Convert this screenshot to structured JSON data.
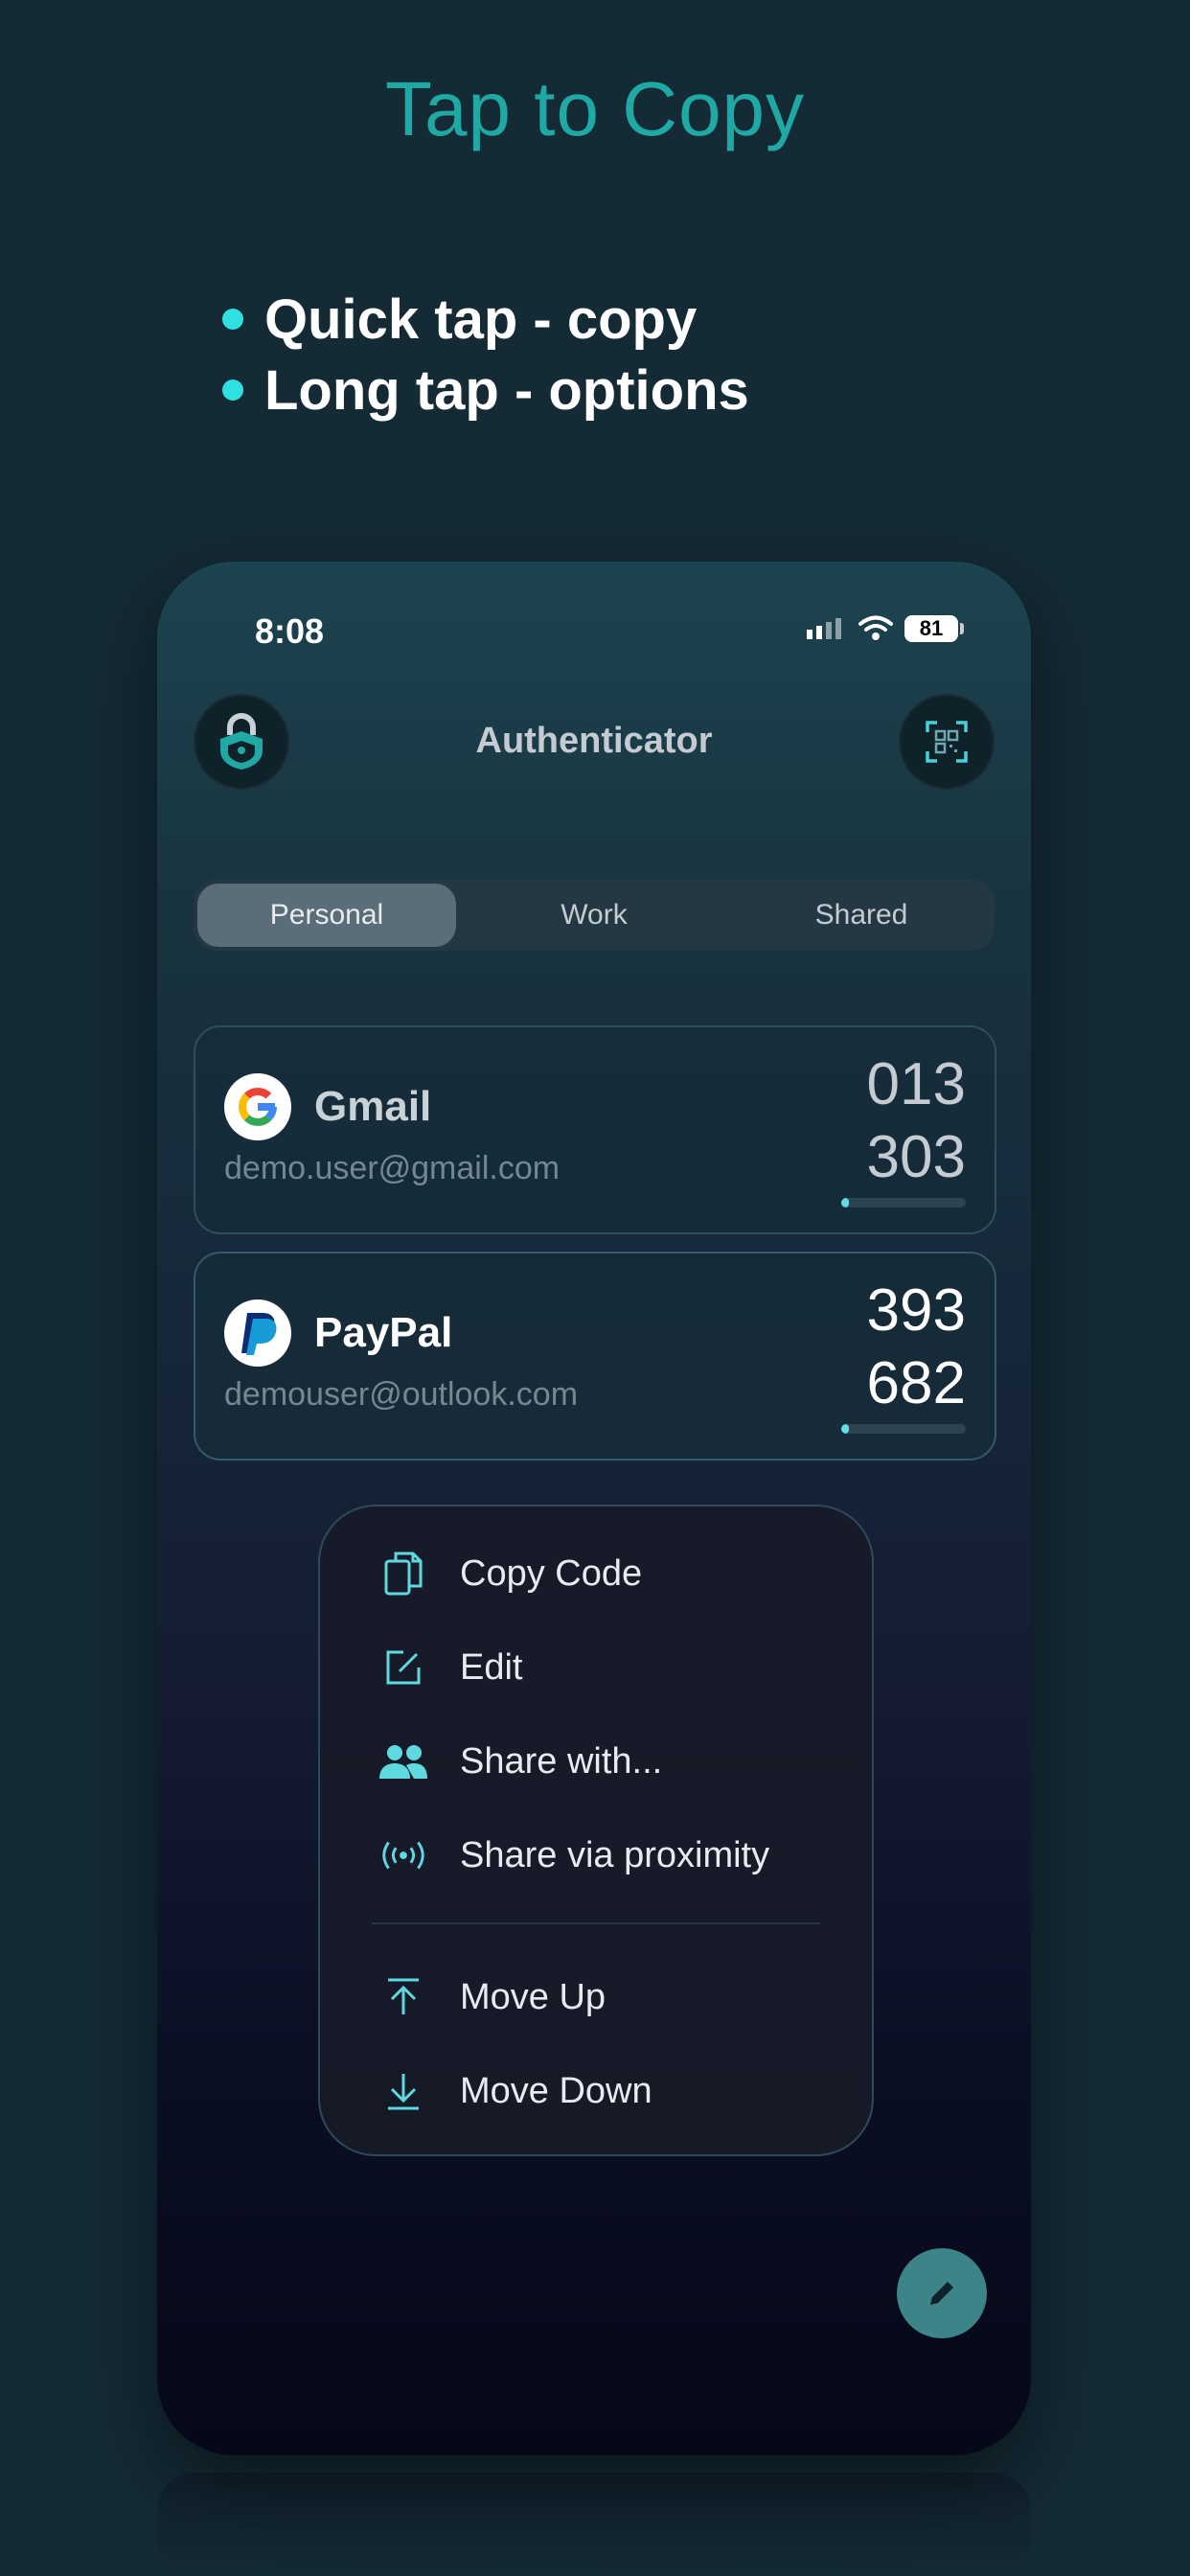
{
  "promo": {
    "headline": "Tap to Copy",
    "bullets": [
      "Quick tap - copy",
      "Long tap - options"
    ]
  },
  "status_bar": {
    "time": "8:08",
    "battery": "81"
  },
  "app": {
    "title": "Authenticator"
  },
  "tabs": [
    {
      "label": "Personal",
      "active": true
    },
    {
      "label": "Work",
      "active": false
    },
    {
      "label": "Shared",
      "active": false
    }
  ],
  "accounts": [
    {
      "service": "Gmail",
      "email": "demo.user@gmail.com",
      "code_top": "013",
      "code_bottom": "303",
      "timer_remaining": 0.06,
      "icon": "google-icon"
    },
    {
      "service": "PayPal",
      "email": "demouser@outlook.com",
      "code_top": "393",
      "code_bottom": "682",
      "timer_remaining": 0.06,
      "icon": "paypal-icon"
    }
  ],
  "context_menu": {
    "items": [
      {
        "label": "Copy Code",
        "icon": "copy-icon"
      },
      {
        "label": "Edit",
        "icon": "edit-icon"
      },
      {
        "label": "Share with...",
        "icon": "people-icon"
      },
      {
        "label": "Share via proximity",
        "icon": "proximity-icon"
      },
      {
        "label": "Move Up",
        "icon": "arrow-up-icon"
      },
      {
        "label": "Move Down",
        "icon": "arrow-down-icon"
      }
    ]
  },
  "colors": {
    "accent": "#1fa8a4",
    "bullet": "#2ee0e0",
    "timer": "#5fdde6",
    "fab": "#3d8488",
    "background": "#142a35"
  }
}
